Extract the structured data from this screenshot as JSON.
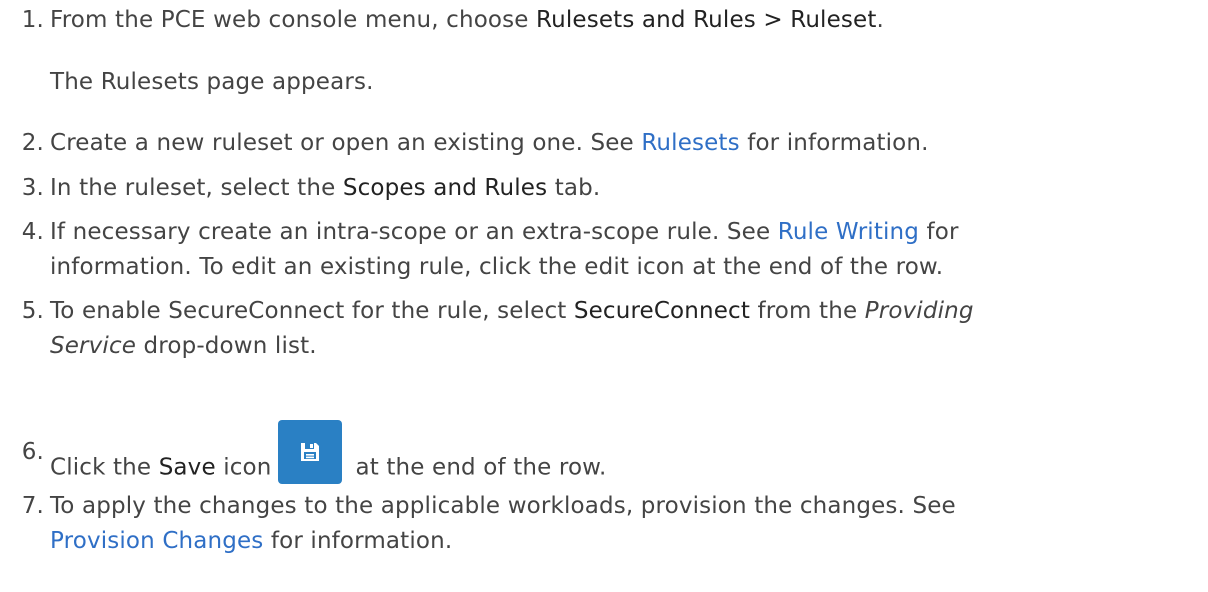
{
  "steps": [
    {
      "num": "1.",
      "lines": [
        {
          "pre": "From the PCE web console menu, choose ",
          "bold": "Rulesets and Rules > Ruleset",
          "post": "."
        },
        {
          "text": "The Rulesets page appears."
        }
      ]
    },
    {
      "num": "2.",
      "pre": "Create a new ruleset or open an existing one. See ",
      "link": "Rulesets",
      "post": " for information."
    },
    {
      "num": "3.",
      "pre": "In the ruleset, select the ",
      "bold": "Scopes and Rules",
      "post": " tab."
    },
    {
      "num": "4.",
      "line1_pre": "If necessary create an intra-scope or an extra-scope rule. See ",
      "line1_link": "Rule Writing",
      "line1_post": " for",
      "line2": "information. To edit an existing rule, click the edit icon at the end of the row."
    },
    {
      "num": "5.",
      "line1_pre": "To enable SecureConnect for the rule, select ",
      "line1_bold": "SecureConnect",
      "line1_mid": " from the ",
      "line1_em": "Providing",
      "line2_em": "Service",
      "line2_post": " drop-down list."
    },
    {
      "num": "6.",
      "pre": "Click the ",
      "bold": "Save",
      "mid": " icon",
      "post": "at the end of the row.",
      "icon": "save-icon"
    },
    {
      "num": "7.",
      "line1": "To apply the changes to the applicable workloads, provision the changes. See",
      "line2_link": "Provision Changes",
      "line2_post": " for information."
    }
  ],
  "colors": {
    "text": "#444444",
    "link": "#2f6fc6",
    "icon_bg": "#2a80c4"
  }
}
